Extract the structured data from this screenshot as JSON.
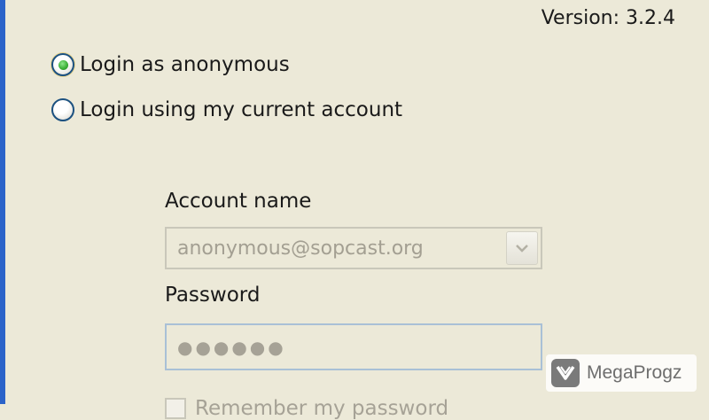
{
  "version_text": "Version: 3.2.4",
  "login_options": [
    {
      "label": "Login as anonymous",
      "selected": true
    },
    {
      "label": "Login using my current account",
      "selected": false
    }
  ],
  "account": {
    "label": "Account name",
    "value": "anonymous@sopcast.org"
  },
  "password": {
    "label": "Password",
    "value": "●●●●●●"
  },
  "remember": {
    "label": "Remember my password"
  },
  "watermark": {
    "text": "MegaProgz"
  },
  "colors": {
    "background": "#ece9d8",
    "radio_selected": "#3fb23a",
    "radio_border": "#1c5180",
    "disabled_text": "#a39f92",
    "window_border": "#2b63c9"
  },
  "icons": {
    "combo_dropdown": "chevron-down-icon",
    "watermark_logo": "megaprogz-logo-icon"
  }
}
